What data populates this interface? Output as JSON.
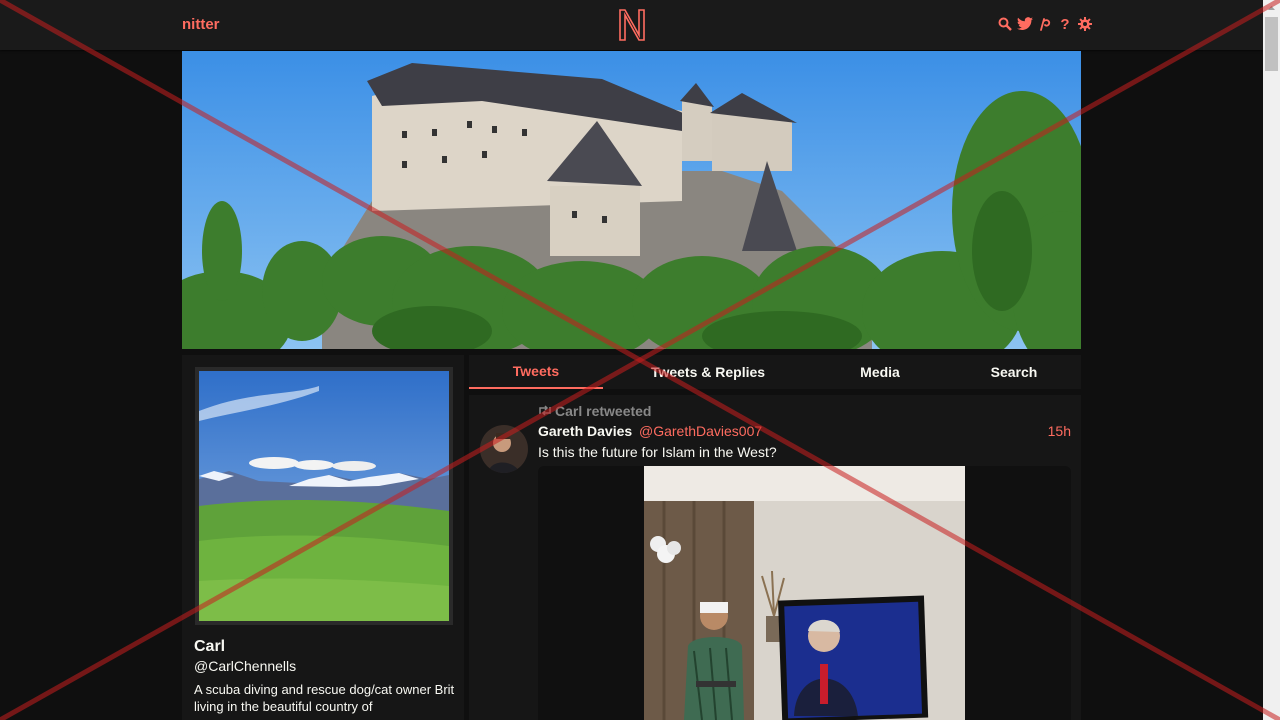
{
  "app": {
    "brand": "nitter"
  },
  "nav": {
    "icons": [
      "search-icon",
      "twitter-icon",
      "rss-icon",
      "help-icon",
      "gear-icon"
    ],
    "help_glyph": "?"
  },
  "colors": {
    "accent": "#ff6c60",
    "bg": "#0f0f0f",
    "panel": "#161616",
    "nav": "#1a1a1a",
    "cross": "#c81e1e"
  },
  "profile": {
    "fullname": "Carl",
    "username": "@CarlChennells",
    "bio": "A scuba diving and rescue dog/cat owner Brit living in the beautiful country of"
  },
  "tabs": [
    {
      "label": "Tweets",
      "active": true
    },
    {
      "label": "Tweets & Replies",
      "active": false
    },
    {
      "label": "Media",
      "active": false
    },
    {
      "label": "Search",
      "active": false
    }
  ],
  "tweet": {
    "retweet_label": "Carl retweeted",
    "fullname": "Gareth Davies",
    "username": "@GarethDavies007",
    "date": "15h",
    "text": "Is this the future for Islam in the West?"
  }
}
